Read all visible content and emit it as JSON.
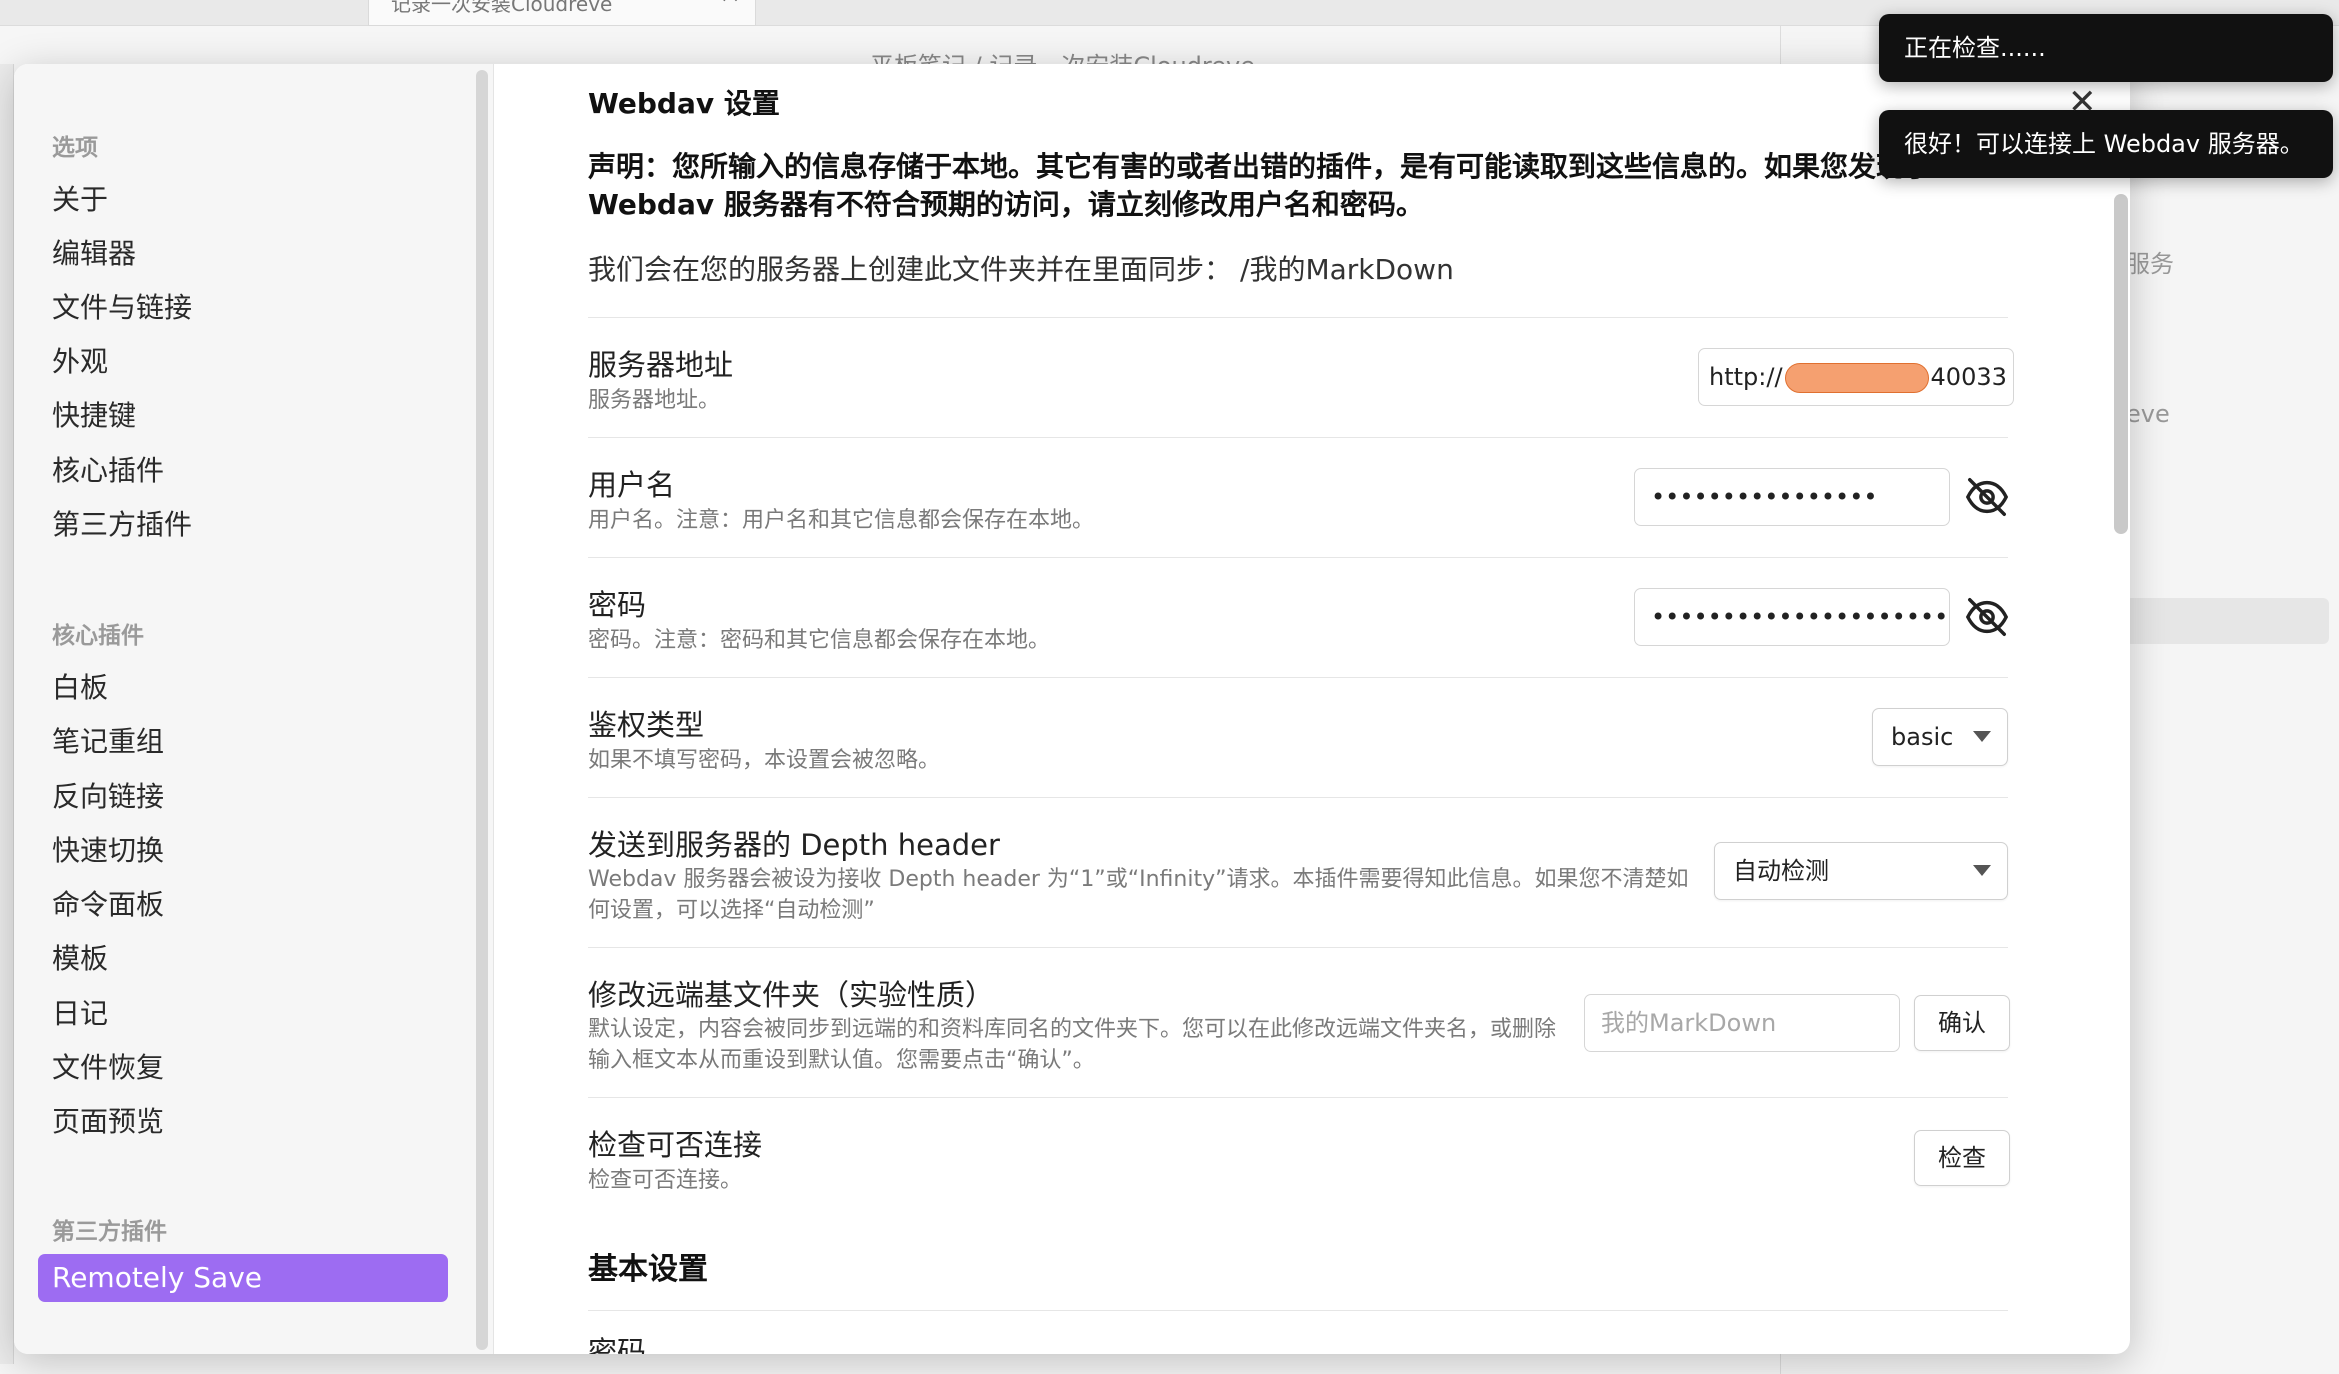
{
  "background": {
    "tab_title": "记录一次安装Cloudreve",
    "breadcrumb": "平板笔记 / 记录一次安装Cloudreve",
    "right_panel_text_1": "服务",
    "right_panel_text_2": "eve"
  },
  "sidebar": {
    "options_heading": "选项",
    "options": [
      "关于",
      "编辑器",
      "文件与链接",
      "外观",
      "快捷键",
      "核心插件",
      "第三方插件"
    ],
    "core_heading": "核心插件",
    "core_plugins": [
      "白板",
      "笔记重组",
      "反向链接",
      "快速切换",
      "命令面板",
      "模板",
      "日记",
      "文件恢复",
      "页面预览"
    ],
    "third_party_heading": "第三方插件",
    "third_party_plugins": [
      "Remotely Save"
    ]
  },
  "settings": {
    "title": "Webdav 设置",
    "disclaimer": "声明：您所输入的信息存储于本地。其它有害的或者出错的插件，是有可能读取到这些信息的。如果您发现了 Webdav 服务器有不符合预期的访问，请立刻修改用户名和密码。",
    "sync_folder_text": "我们会在您的服务器上创建此文件夹并在里面同步：",
    "sync_folder_path": "/我的MarkDown",
    "server_address": {
      "name": "服务器地址",
      "desc": "服务器地址。",
      "value_prefix": "http://",
      "value_suffix": "40033"
    },
    "username": {
      "name": "用户名",
      "desc": "用户名。注意：用户名和其它信息都会保存在本地。",
      "value": "••••••••••••••••"
    },
    "password": {
      "name": "密码",
      "desc": "密码。注意：密码和其它信息都会保存在本地。",
      "value": "••••••••••••••••••••••••••••"
    },
    "auth_type": {
      "name": "鉴权类型",
      "desc": "如果不填写密码，本设置会被忽略。",
      "value": "basic"
    },
    "depth_header": {
      "name": "发送到服务器的 Depth header",
      "desc": "Webdav 服务器会被设为接收 Depth header 为“1”或“Infinity”请求。本插件需要得知此信息。如果您不清楚如何设置，可以选择“自动检测”",
      "value": "自动检测"
    },
    "remote_base_dir": {
      "name": "修改远端基文件夹（实验性质）",
      "desc": "默认设定，内容会被同步到远端的和资料库同名的文件夹下。您可以在此修改远端文件夹名，或删除输入框文本从而重设到默认值。您需要点击“确认”。",
      "placeholder": "我的MarkDown",
      "button": "确认"
    },
    "check_connection": {
      "name": "检查可否连接",
      "desc": "检查可否连接。",
      "button": "检查"
    },
    "basic_settings_title": "基本设置",
    "next_row_name": "密码"
  },
  "toasts": {
    "checking": "正在检查......",
    "success": "很好！可以连接上 Webdav 服务器。"
  },
  "colors": {
    "accent": "#9d6cf2",
    "redaction": "#f5a070"
  }
}
